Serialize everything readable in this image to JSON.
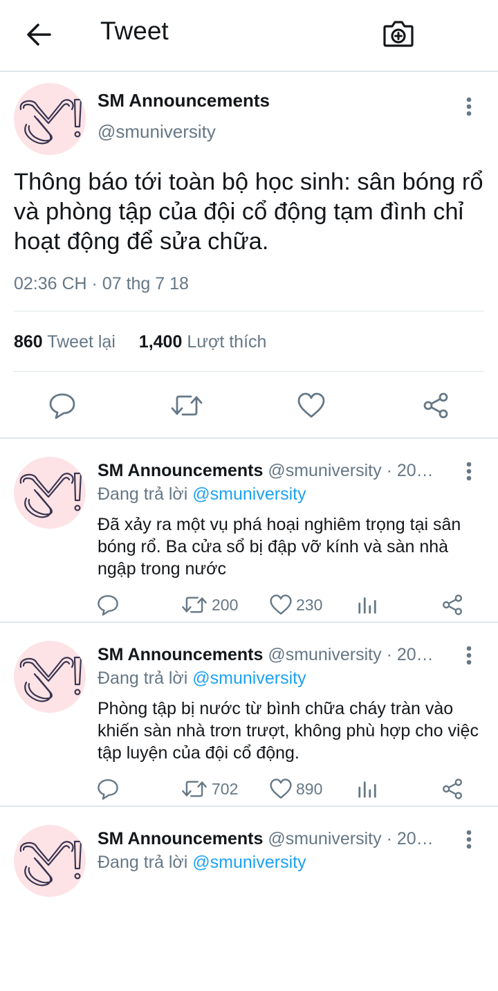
{
  "header": {
    "title": "Tweet",
    "back_icon": "arrow-left-icon",
    "camera_icon": "camera-plus-icon"
  },
  "main_tweet": {
    "author_name": "SM Announcements",
    "author_handle": "@smuniversity",
    "text": "Thông báo tới toàn bộ học sinh: sân bóng rổ và phòng tập của đội cổ động tạm đình chỉ hoạt động để sửa chữa.",
    "timestamp": "02:36 CH · 07 thg 7 18",
    "retweets_count": "860",
    "retweets_label": "Tweet lại",
    "likes_count": "1,400",
    "likes_label": "Lượt thích"
  },
  "replies": [
    {
      "author_name": "SM Announcements",
      "author_handle": "@smuniversity · 20…",
      "replying_prefix": "Đang trả lời",
      "replying_to": "@smuniversity",
      "text": "Đã xảy ra một vụ phá hoại nghiêm trọng tại sân bóng rổ. Ba cửa sổ bị đập vỡ kính và sàn nhà ngập trong nước",
      "retweets": "200",
      "likes": "230"
    },
    {
      "author_name": "SM Announcements",
      "author_handle": "@smuniversity · 20…",
      "replying_prefix": "Đang trả lời",
      "replying_to": "@smuniversity",
      "text": "Phòng tập bị nước từ bình chữa cháy tràn vào khiến sàn nhà trơn trượt, không phù hợp cho việc tập luyện của đội cổ động.",
      "retweets": "702",
      "likes": "890"
    },
    {
      "author_name": "SM Announcements",
      "author_handle": "@smuniversity · 20…",
      "replying_prefix": "Đang trả lời",
      "replying_to": "@smuniversity",
      "text": "",
      "retweets": "",
      "likes": ""
    }
  ],
  "colors": {
    "accent": "#1da1f2",
    "secondary_text": "#657786",
    "icon": "#657786",
    "avatar_bg": "#fde3e6",
    "logo_stroke": "#3a3550"
  }
}
